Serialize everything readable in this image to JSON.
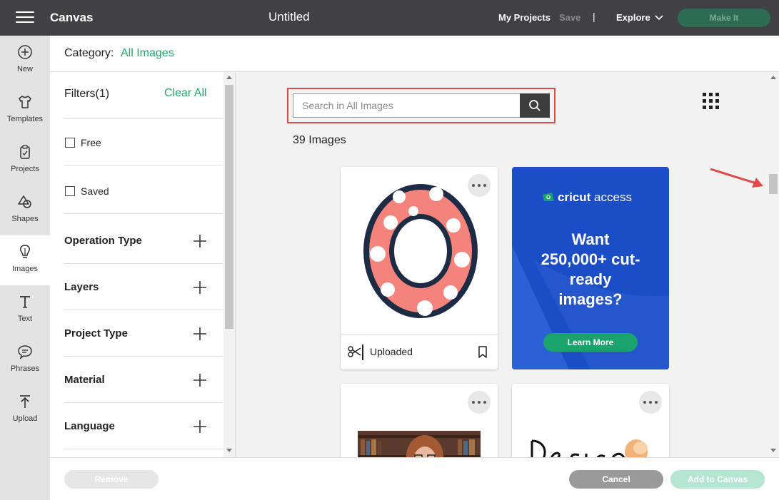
{
  "topbar": {
    "app_title": "Canvas",
    "doc_title": "Untitled",
    "my_projects": "My Projects",
    "save": "Save",
    "separator": "|",
    "explore": "Explore",
    "make_it": "Make It"
  },
  "rail": {
    "items": [
      {
        "label": "New",
        "icon": "plus-circle-icon"
      },
      {
        "label": "Templates",
        "icon": "tshirt-icon"
      },
      {
        "label": "Projects",
        "icon": "clipboard-icon"
      },
      {
        "label": "Shapes",
        "icon": "shapes-icon"
      },
      {
        "label": "Images",
        "icon": "lightbulb-icon",
        "active": true
      },
      {
        "label": "Text",
        "icon": "text-icon"
      },
      {
        "label": "Phrases",
        "icon": "speech-bubble-icon"
      },
      {
        "label": "Upload",
        "icon": "upload-icon"
      }
    ]
  },
  "category": {
    "label": "Category:",
    "value": "All Images"
  },
  "filters": {
    "title": "Filters(1)",
    "clear_all": "Clear All",
    "checkboxes": [
      {
        "label": "Free",
        "checked": false
      },
      {
        "label": "Saved",
        "checked": false
      }
    ],
    "sections": [
      "Operation Type",
      "Layers",
      "Project Type",
      "Material",
      "Language"
    ]
  },
  "search": {
    "placeholder": "Search in All Images",
    "value": ""
  },
  "results": {
    "count_text": "39 Images"
  },
  "cards": {
    "first": {
      "source": "Uploaded"
    },
    "ad": {
      "brand_bold": "cricut",
      "brand_light": "access",
      "headline": "Want 250,000+ cut-ready images?",
      "button": "Learn More"
    }
  },
  "bottombar": {
    "remove": "Remove",
    "cancel": "Cancel",
    "add_to_canvas": "Add to Canvas"
  },
  "colors": {
    "accent_green": "#25a36a",
    "topbar": "#414042",
    "ad_blue": "#1a4dc6",
    "highlight_red": "#e04a4a"
  }
}
